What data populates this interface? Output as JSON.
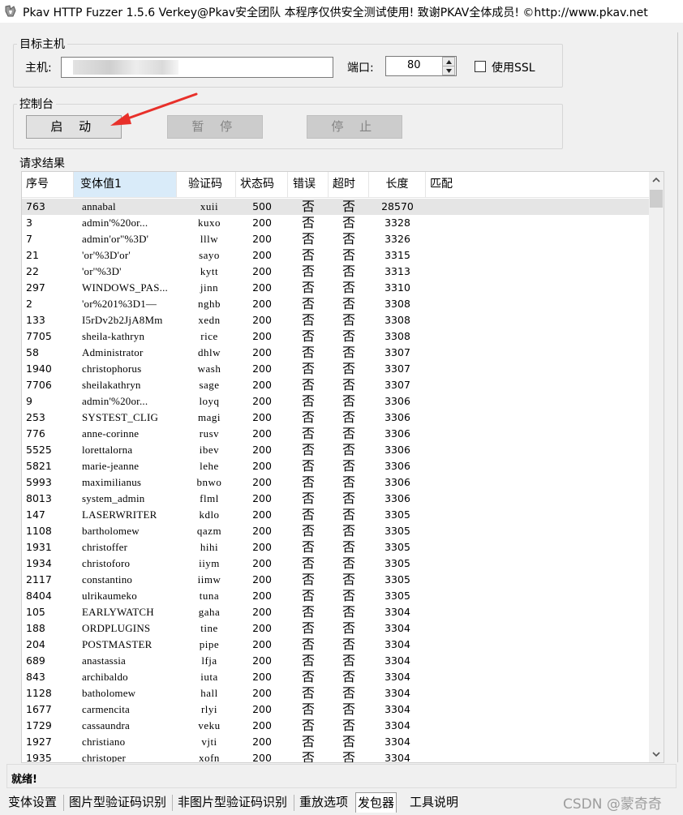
{
  "window": {
    "title": "Pkav HTTP Fuzzer 1.5.6  Verkey@Pkav安全团队  本程序仅供安全测试使用!  致谢PKAV全体成员! ©http://www.pkav.net"
  },
  "target_host": {
    "group_label": "目标主机",
    "host_label": "主机:",
    "host_value": "",
    "port_label": "端口:",
    "port_value": "80",
    "ssl_label": "使用SSL",
    "ssl_checked": false
  },
  "console": {
    "group_label": "控制台",
    "start_label": "启 动",
    "pause_label": "暂 停",
    "stop_label": "停 止"
  },
  "results": {
    "group_label": "请求结果",
    "columns": [
      "序号",
      "变体值1",
      "验证码",
      "状态码",
      "错误",
      "超时",
      "长度",
      "匹配"
    ],
    "rows": [
      {
        "seq": "763",
        "val": "annabal",
        "cap": "xuii",
        "status": "500",
        "err": "否",
        "timeout": "否",
        "len": "28570"
      },
      {
        "seq": "3",
        "val": "admin'%20or...",
        "cap": "kuxo",
        "status": "200",
        "err": "否",
        "timeout": "否",
        "len": "3328"
      },
      {
        "seq": "7",
        "val": "admin'or''%3D'",
        "cap": "lllw",
        "status": "200",
        "err": "否",
        "timeout": "否",
        "len": "3326"
      },
      {
        "seq": "21",
        "val": "'or'%3D'or'",
        "cap": "sayo",
        "status": "200",
        "err": "否",
        "timeout": "否",
        "len": "3315"
      },
      {
        "seq": "22",
        "val": "'or''%3D'",
        "cap": "kytt",
        "status": "200",
        "err": "否",
        "timeout": "否",
        "len": "3313"
      },
      {
        "seq": "297",
        "val": "WINDOWS_PAS...",
        "cap": "jinn",
        "status": "200",
        "err": "否",
        "timeout": "否",
        "len": "3310"
      },
      {
        "seq": "2",
        "val": "'or%201%3D1—",
        "cap": "nghb",
        "status": "200",
        "err": "否",
        "timeout": "否",
        "len": "3308"
      },
      {
        "seq": "133",
        "val": "I5rDv2b2JjA8Mm",
        "cap": "xedn",
        "status": "200",
        "err": "否",
        "timeout": "否",
        "len": "3308"
      },
      {
        "seq": "7705",
        "val": "sheila-kathryn",
        "cap": "rice",
        "status": "200",
        "err": "否",
        "timeout": "否",
        "len": "3308"
      },
      {
        "seq": "58",
        "val": "Administrator",
        "cap": "dhlw",
        "status": "200",
        "err": "否",
        "timeout": "否",
        "len": "3307"
      },
      {
        "seq": "1940",
        "val": "christophorus",
        "cap": "wash",
        "status": "200",
        "err": "否",
        "timeout": "否",
        "len": "3307"
      },
      {
        "seq": "7706",
        "val": "sheilakathryn",
        "cap": "sage",
        "status": "200",
        "err": "否",
        "timeout": "否",
        "len": "3307"
      },
      {
        "seq": "9",
        "val": "admin'%20or...",
        "cap": "loyq",
        "status": "200",
        "err": "否",
        "timeout": "否",
        "len": "3306"
      },
      {
        "seq": "253",
        "val": "SYSTEST_CLIG",
        "cap": "magi",
        "status": "200",
        "err": "否",
        "timeout": "否",
        "len": "3306"
      },
      {
        "seq": "776",
        "val": "anne-corinne",
        "cap": "rusv",
        "status": "200",
        "err": "否",
        "timeout": "否",
        "len": "3306"
      },
      {
        "seq": "5525",
        "val": "lorettalorna",
        "cap": "ibev",
        "status": "200",
        "err": "否",
        "timeout": "否",
        "len": "3306"
      },
      {
        "seq": "5821",
        "val": "marie-jeanne",
        "cap": "lehe",
        "status": "200",
        "err": "否",
        "timeout": "否",
        "len": "3306"
      },
      {
        "seq": "5993",
        "val": "maximilianus",
        "cap": "bnwo",
        "status": "200",
        "err": "否",
        "timeout": "否",
        "len": "3306"
      },
      {
        "seq": "8013",
        "val": "system_admin",
        "cap": "flml",
        "status": "200",
        "err": "否",
        "timeout": "否",
        "len": "3306"
      },
      {
        "seq": "147",
        "val": "LASERWRITER",
        "cap": "kdlo",
        "status": "200",
        "err": "否",
        "timeout": "否",
        "len": "3305"
      },
      {
        "seq": "1108",
        "val": "bartholomew",
        "cap": "qazm",
        "status": "200",
        "err": "否",
        "timeout": "否",
        "len": "3305"
      },
      {
        "seq": "1931",
        "val": "christoffer",
        "cap": "hihi",
        "status": "200",
        "err": "否",
        "timeout": "否",
        "len": "3305"
      },
      {
        "seq": "1934",
        "val": "christoforo",
        "cap": "iiym",
        "status": "200",
        "err": "否",
        "timeout": "否",
        "len": "3305"
      },
      {
        "seq": "2117",
        "val": "constantino",
        "cap": "iimw",
        "status": "200",
        "err": "否",
        "timeout": "否",
        "len": "3305"
      },
      {
        "seq": "8404",
        "val": "ulrikaumeko",
        "cap": "tuna",
        "status": "200",
        "err": "否",
        "timeout": "否",
        "len": "3305"
      },
      {
        "seq": "105",
        "val": "EARLYWATCH",
        "cap": "gaha",
        "status": "200",
        "err": "否",
        "timeout": "否",
        "len": "3304"
      },
      {
        "seq": "188",
        "val": "ORDPLUGINS",
        "cap": "tine",
        "status": "200",
        "err": "否",
        "timeout": "否",
        "len": "3304"
      },
      {
        "seq": "204",
        "val": "POSTMASTER",
        "cap": "pipe",
        "status": "200",
        "err": "否",
        "timeout": "否",
        "len": "3304"
      },
      {
        "seq": "689",
        "val": "anastassia",
        "cap": "lfja",
        "status": "200",
        "err": "否",
        "timeout": "否",
        "len": "3304"
      },
      {
        "seq": "843",
        "val": "archibaldo",
        "cap": "iuta",
        "status": "200",
        "err": "否",
        "timeout": "否",
        "len": "3304"
      },
      {
        "seq": "1128",
        "val": "batholomew",
        "cap": "hall",
        "status": "200",
        "err": "否",
        "timeout": "否",
        "len": "3304"
      },
      {
        "seq": "1677",
        "val": "carmencita",
        "cap": "rlyi",
        "status": "200",
        "err": "否",
        "timeout": "否",
        "len": "3304"
      },
      {
        "seq": "1729",
        "val": "cassaundra",
        "cap": "veku",
        "status": "200",
        "err": "否",
        "timeout": "否",
        "len": "3304"
      },
      {
        "seq": "1927",
        "val": "christiano",
        "cap": "vjti",
        "status": "200",
        "err": "否",
        "timeout": "否",
        "len": "3304"
      },
      {
        "seq": "1935",
        "val": "christoper",
        "cap": "xofn",
        "status": "200",
        "err": "否",
        "timeout": "否",
        "len": "3304"
      }
    ]
  },
  "status_bar": {
    "text": "就绪!"
  },
  "tabs": [
    "变体设置",
    "图片型验证码识别",
    "非图片型验证码识别",
    "重放选项",
    "发包器",
    "工具说明"
  ],
  "active_tab": "发包器",
  "watermark": "CSDN @蒙奇奇",
  "colors": {
    "annotation_arrow": "#e8302a",
    "header_highlight": "#d9ebf9",
    "selected_row": "#e5e5e5"
  }
}
